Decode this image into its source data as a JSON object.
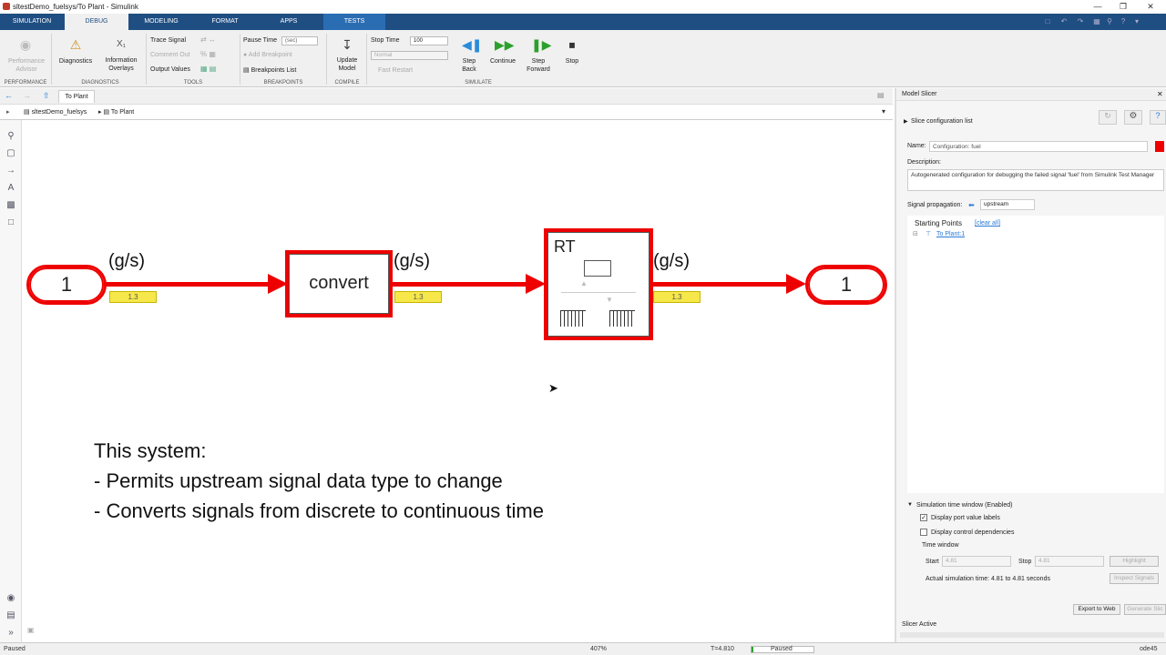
{
  "window": {
    "title": "sltestDemo_fuelsys/To Plant - Simulink"
  },
  "ribbon_tabs": [
    "SIMULATION",
    "DEBUG",
    "MODELING",
    "FORMAT",
    "APPS",
    "TESTS"
  ],
  "active_tab": "DEBUG",
  "ribbon": {
    "performance_advisor": "Performance\nAdvisor",
    "diagnostics": "Diagnostics",
    "information_overlays": "Information\nOverlays",
    "trace_signal": "Trace Signal",
    "comment_out": "Comment Out",
    "output_values": "Output Values",
    "pause_time_label": "Pause Time",
    "pause_time_placeholder": "(sec)",
    "add_breakpoint": "Add Breakpoint",
    "breakpoints_list": "Breakpoints List",
    "update_model": "Update\nModel",
    "stop_time_label": "Stop Time",
    "stop_time_value": "100",
    "mode_value": "Normal",
    "fast_restart": "Fast Restart",
    "step_back": "Step\nBack",
    "continue": "Continue",
    "step_forward": "Step\nForward",
    "stop": "Stop",
    "groups": [
      "PERFORMANCE",
      "DIAGNOSTICS",
      "TOOLS",
      "BREAKPOINTS",
      "COMPILE",
      "SIMULATE"
    ]
  },
  "editor": {
    "tab": "To Plant",
    "breadcrumb": [
      "sltestDemo_fuelsys",
      "To Plant"
    ]
  },
  "diagram": {
    "inport_label": "1",
    "outport_label": "1",
    "convert_label": "convert",
    "rt_label": "RT",
    "signal_units": [
      "(g/s)",
      "(g/s)",
      "(g/s)"
    ],
    "port_values": [
      "1.3",
      "1.3",
      "1.3"
    ],
    "note_lines": [
      "This system:",
      "- Permits upstream signal data type to change",
      "- Converts signals from discrete to continuous time"
    ]
  },
  "slicer": {
    "title": "Model Slicer",
    "config_list": "Slice configuration list",
    "name_label": "Name:",
    "name_value": "Configuration: fuel",
    "description_label": "Description:",
    "description_value": "Autogenerated configuration for debugging the failed signal 'fuel' from Simulink Test Manager",
    "propagation_label": "Signal propagation:",
    "propagation_value": "upstream",
    "starting_points": "Starting Points",
    "clear_all": "[clear all]",
    "start_item": "To Plant:1",
    "sim_window": "Simulation time window (Enabled)",
    "display_port_values": "Display port value labels",
    "display_control_deps": "Display control dependencies",
    "time_window": "Time window",
    "start_label": "Start",
    "start_value": "4.81",
    "stop_label": "Stop",
    "stop_value": "4.81",
    "highlight": "Highlight",
    "actual_time": "Actual simulation time: 4.81 to 4.81 seconds",
    "inspect_signals": "Inspect Signals",
    "export_web": "Export to Web",
    "generate_slice": "Generate Slic",
    "slicer_active": "Slicer Active"
  },
  "status": {
    "left": "Paused",
    "zoom": "407%",
    "time": "T=4.810",
    "state": "Paused",
    "solver": "ode45"
  }
}
